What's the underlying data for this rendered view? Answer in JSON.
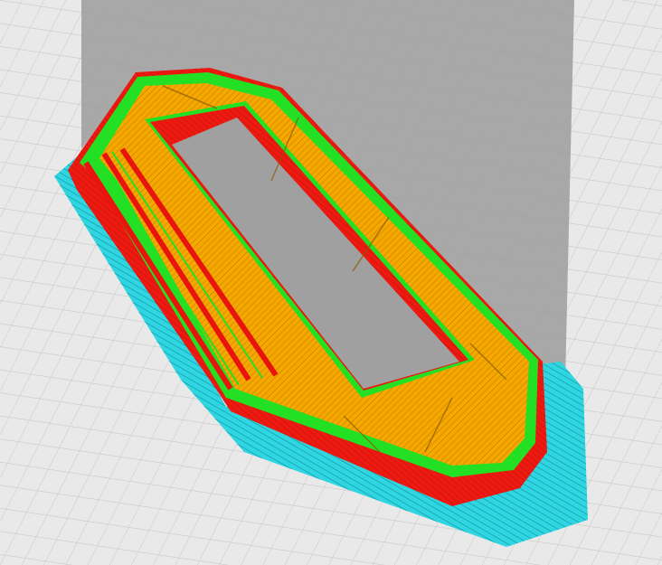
{
  "viewport": {
    "view": "layer-preview",
    "colors": {
      "background": "#e6e6e6",
      "grid": "#c9c9c9",
      "build_volume_shadow": "#9a9a9a",
      "skirt": "#27d3df",
      "wall_outer": "#e8140e",
      "wall_inner": "#22e022",
      "infill": "#f2a500",
      "infill_lines": "#c97a00"
    }
  }
}
